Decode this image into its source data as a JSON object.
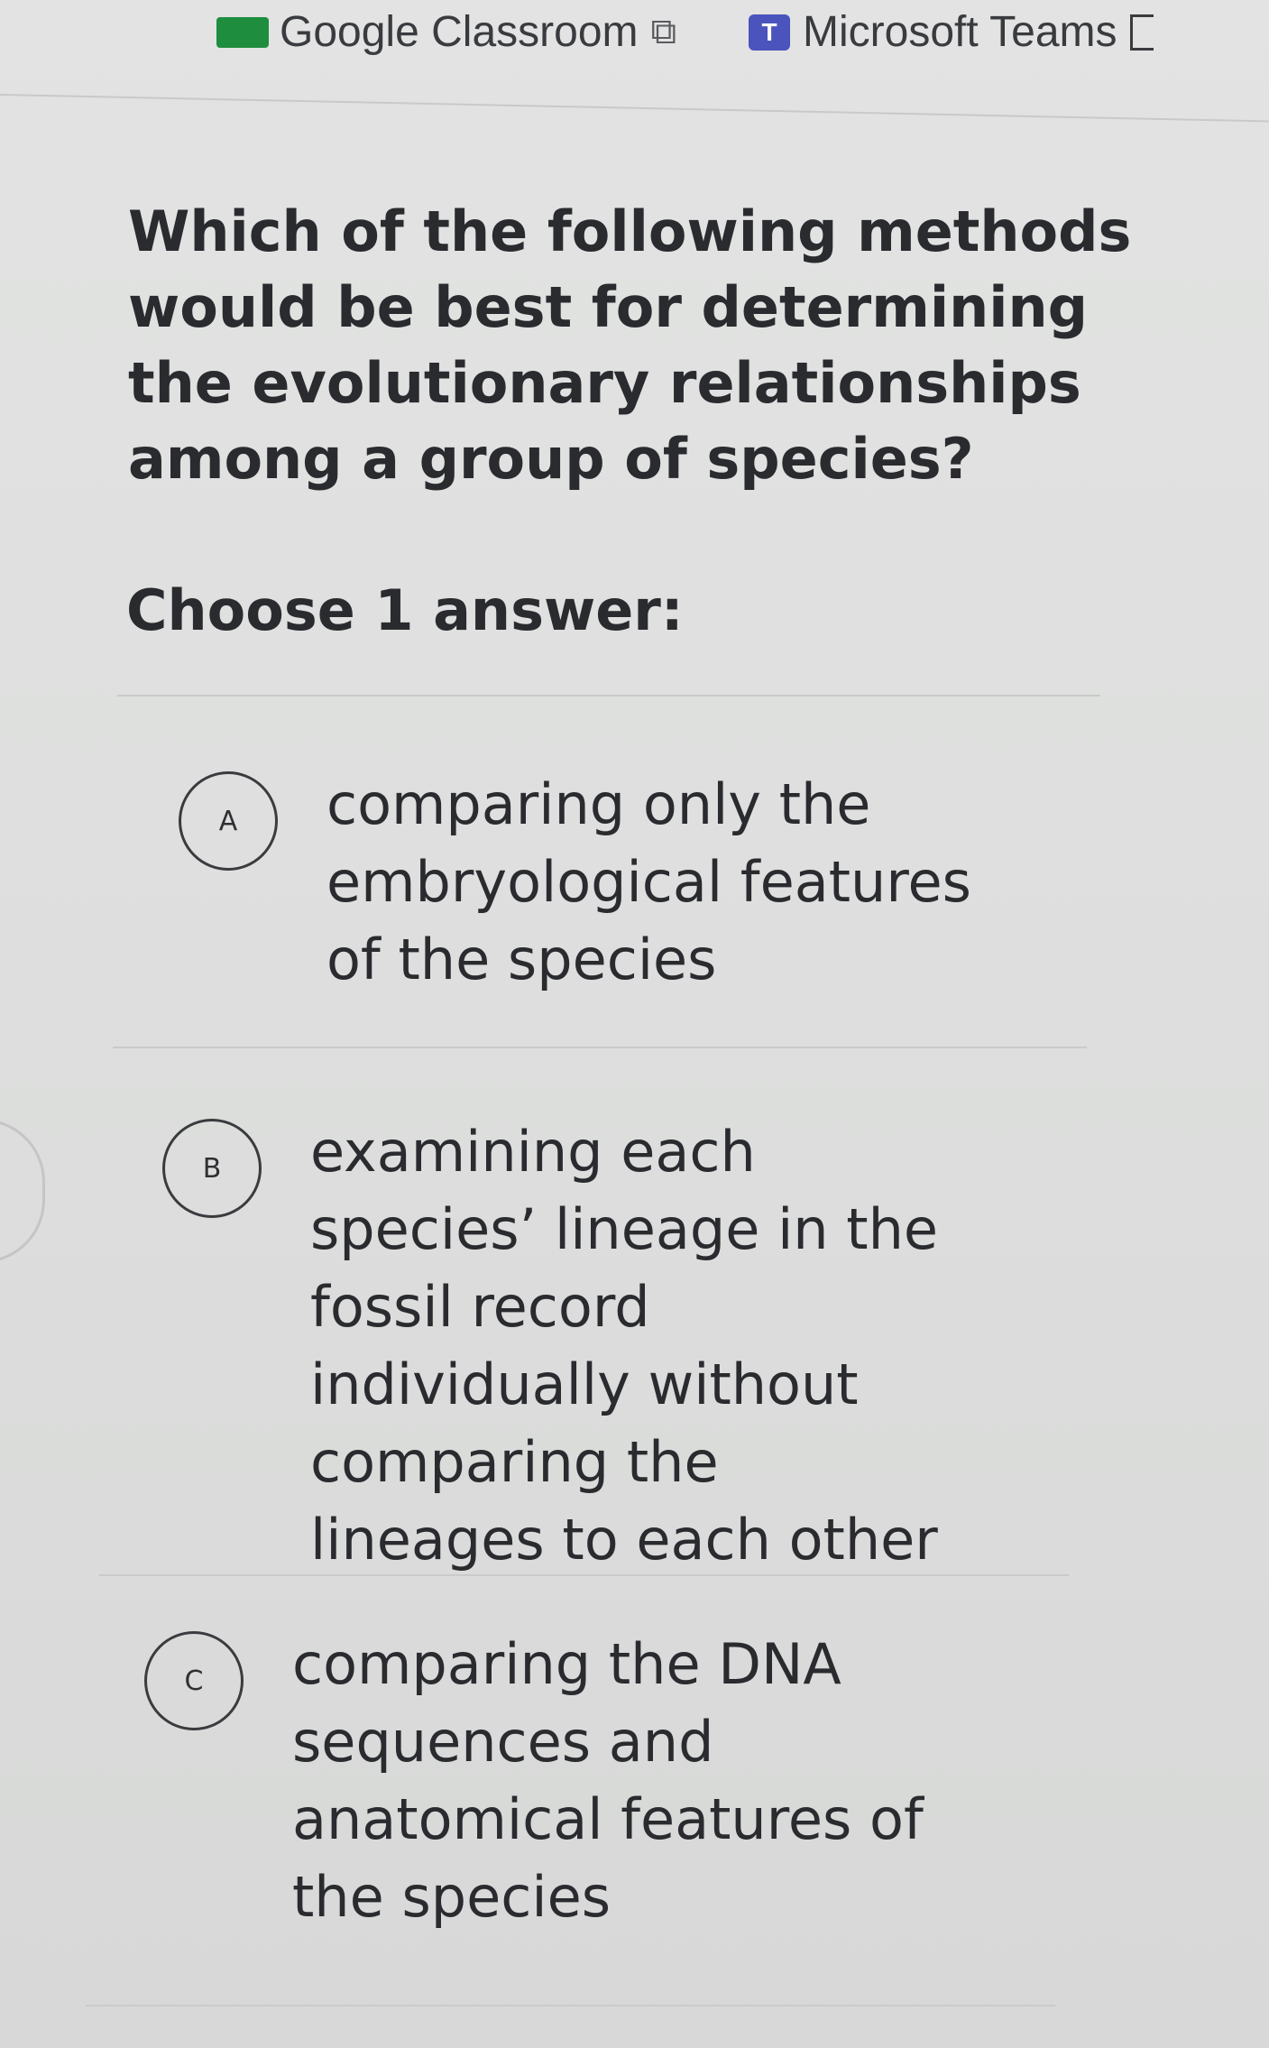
{
  "bookmarks": [
    {
      "label": "Google Classroom",
      "icon": "google-classroom-icon"
    },
    {
      "label": "Microsoft Teams",
      "icon": "microsoft-teams-icon"
    }
  ],
  "question": {
    "text": "Which of the following methods would be best for determining the evolutionary relationships among a group of species?",
    "instruction": "Choose 1 answer:"
  },
  "choices": [
    {
      "letter": "A",
      "text": "comparing only the embryological features of the species"
    },
    {
      "letter": "B",
      "text": "examining each species’ lineage in the fossil record individually without comparing the lineages to each other"
    },
    {
      "letter": "C",
      "text": "comparing the DNA sequences and anatomical features of the species"
    }
  ],
  "colors": {
    "background": "#dddedd",
    "text": "#2a2b2f",
    "divider": "#c9cac9",
    "teams_brand": "#4b53bc",
    "classroom_brand": "#1e8e3e"
  }
}
